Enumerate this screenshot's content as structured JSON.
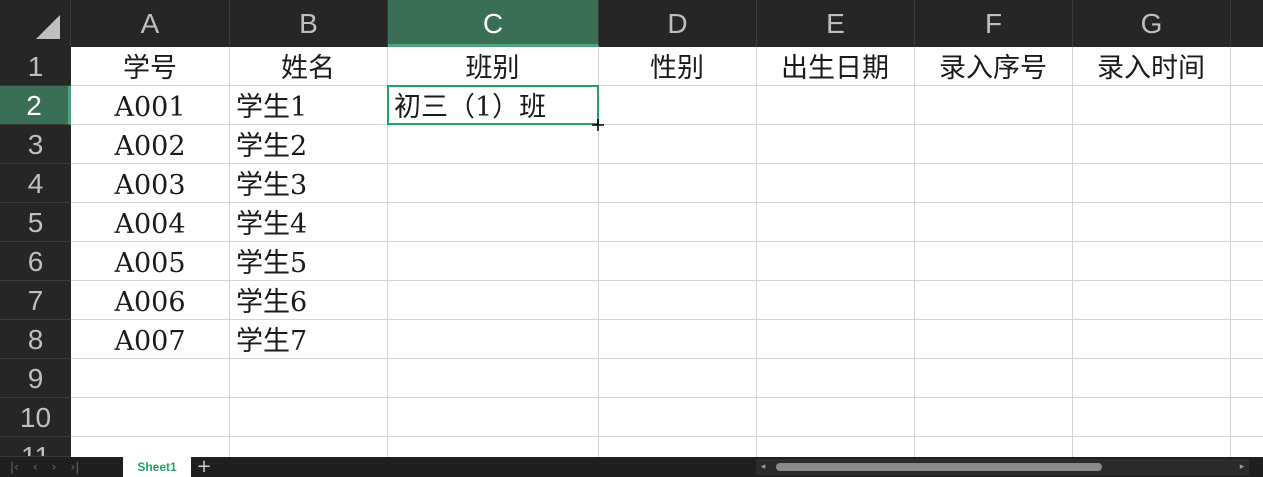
{
  "columns": [
    "A",
    "B",
    "C",
    "D",
    "E",
    "F",
    "G"
  ],
  "rows": [
    "1",
    "2",
    "3",
    "4",
    "5",
    "6",
    "7",
    "8",
    "9",
    "10",
    "11"
  ],
  "active_column": "C",
  "active_row": "2",
  "headers": {
    "A": "学号",
    "B": "姓名",
    "C": "班别",
    "D": "性别",
    "E": "出生日期",
    "F": "录入序号",
    "G": "录入时间"
  },
  "data_rows": [
    {
      "A": "A001",
      "B": "学生1",
      "C": "初三（1）班"
    },
    {
      "A": "A002",
      "B": "学生2",
      "C": ""
    },
    {
      "A": "A003",
      "B": "学生3",
      "C": ""
    },
    {
      "A": "A004",
      "B": "学生4",
      "C": ""
    },
    {
      "A": "A005",
      "B": "学生5",
      "C": ""
    },
    {
      "A": "A006",
      "B": "学生6",
      "C": ""
    },
    {
      "A": "A007",
      "B": "学生7",
      "C": ""
    }
  ],
  "sheet_tabs": [
    "Sheet1"
  ],
  "add_sheet_label": "+",
  "colors": {
    "accent": "#21a366",
    "active_header": "#3b6e57",
    "header_bg": "#262626",
    "gridline": "#d4d4d4"
  },
  "icons": {
    "select_all": "select-all-triangle-icon",
    "fill_handle": "crosshair-cursor-icon",
    "nav_first": "first-sheet-icon",
    "nav_prev": "prev-sheet-icon",
    "nav_next": "next-sheet-icon",
    "nav_last": "last-sheet-icon"
  }
}
